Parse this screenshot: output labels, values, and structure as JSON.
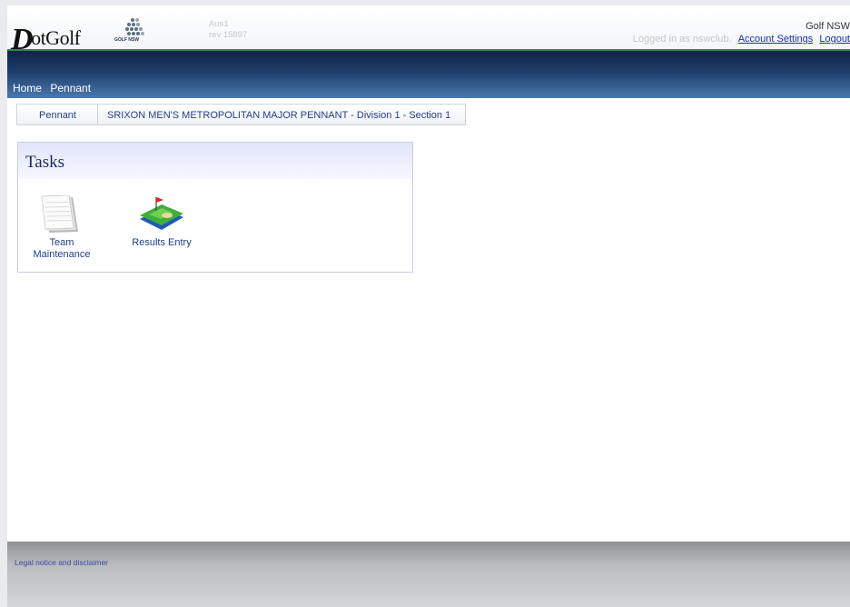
{
  "header": {
    "logo_text": "otGolf",
    "logo_initial": "D",
    "partner_logo_text": "GOLF NSW",
    "env": "Aus1",
    "rev": "rev 15897",
    "org_name": "Golf NSW",
    "logged_in_text": "Logged in as nswclub.",
    "account_settings": "Account Settings",
    "logout": "Logout"
  },
  "nav": {
    "items": [
      "Home",
      "Pennant"
    ]
  },
  "breadcrumb": {
    "items": [
      "Pennant",
      "SRIXON MEN'S METROPOLITAN MAJOR PENNANT - Division 1 - Section 1"
    ]
  },
  "tasks": {
    "title": "Tasks",
    "items": [
      {
        "label_line1": "Team",
        "label_line2": "Maintenance",
        "icon": "document-icon"
      },
      {
        "label_line1": "Results Entry",
        "label_line2": "",
        "icon": "golf-green-icon"
      }
    ]
  },
  "footer": {
    "legal": "Legal notice and disclaimer"
  },
  "colors": {
    "nav_dark": "#102346",
    "nav_light": "#4a79b2",
    "link": "#1a2fb0",
    "header_border": "#2d8a4b"
  }
}
